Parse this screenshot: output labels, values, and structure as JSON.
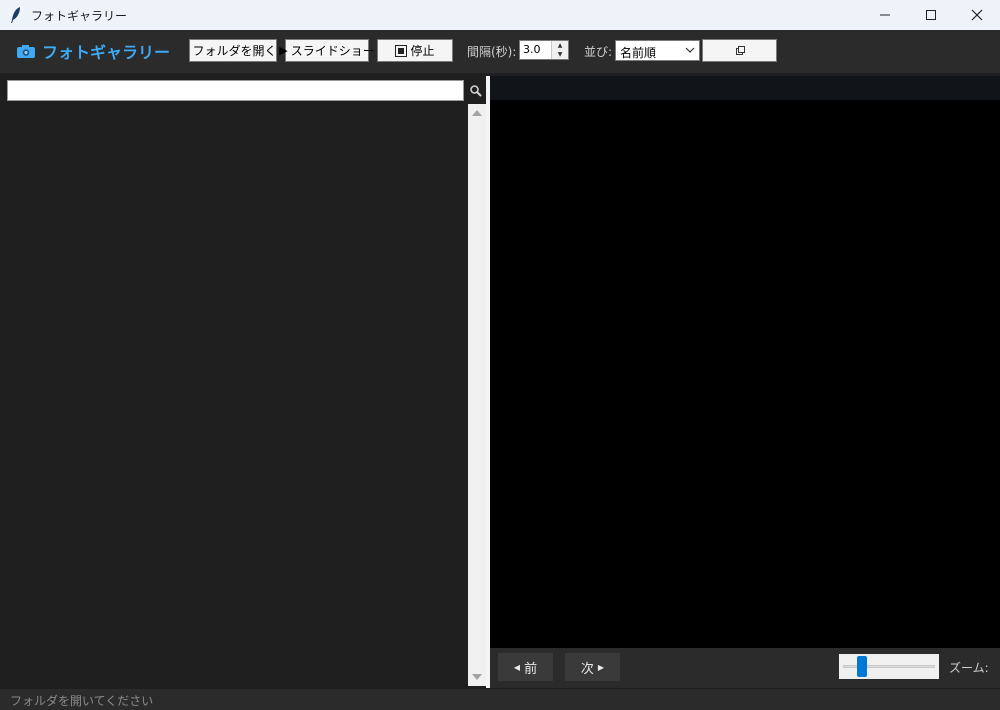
{
  "window": {
    "title": "フォトギャラリー",
    "icon": "feather-icon"
  },
  "toolbar": {
    "app_title": "フォトギャラリー",
    "app_icon": "camera-icon",
    "open_folder_label": "フォルダを開く",
    "open_folder_icon": "folder-icon",
    "slideshow_label": "スライドショー",
    "slideshow_icon": "play-icon",
    "stop_label": "停止",
    "stop_icon": "stop-icon",
    "interval_label": "間隔(秒):",
    "interval_value": "3.0",
    "sort_label": "並び:",
    "sort_value": "名前順",
    "copy_icon": "copy-icon"
  },
  "search": {
    "value": "",
    "icon": "magnifier-icon"
  },
  "viewer": {
    "prev_label": "前",
    "next_label": "次",
    "zoom_label": "ズーム:",
    "zoom_fraction": 0.17
  },
  "status": {
    "text": "フォルダを開いてください"
  },
  "colors": {
    "accent": "#3fa9f5",
    "background": "#1f1f1f",
    "toolbar": "#2b2b2b",
    "canvas": "#000000",
    "slider_thumb": "#0078d7"
  }
}
